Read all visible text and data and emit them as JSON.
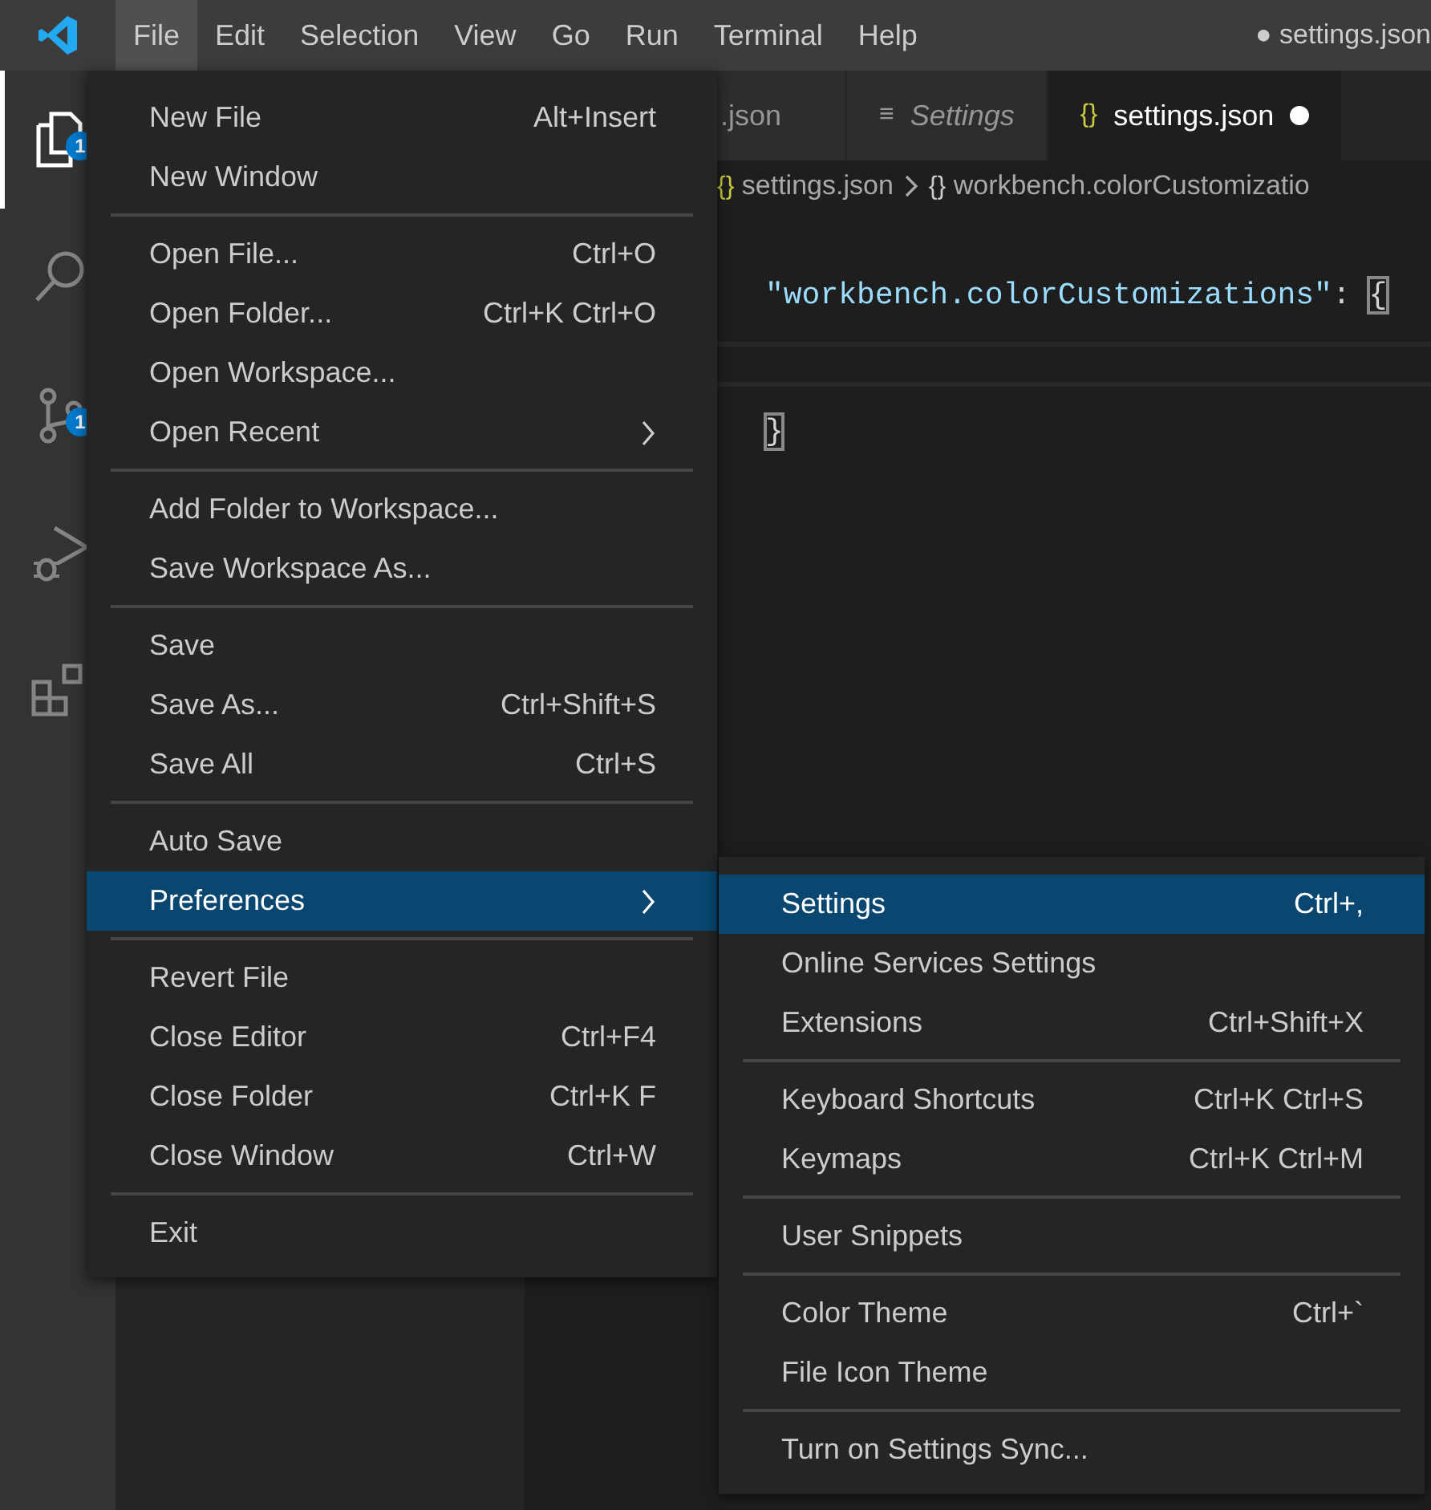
{
  "menubar": {
    "items": [
      {
        "label": "File",
        "selected": true
      },
      {
        "label": "Edit",
        "selected": false
      },
      {
        "label": "Selection",
        "selected": false
      },
      {
        "label": "View",
        "selected": false
      },
      {
        "label": "Go",
        "selected": false
      },
      {
        "label": "Run",
        "selected": false
      },
      {
        "label": "Terminal",
        "selected": false
      },
      {
        "label": "Help",
        "selected": false
      }
    ],
    "window_title": "● settings.json"
  },
  "activity_bar": {
    "items": [
      {
        "kind": "explorer",
        "selected": true,
        "badge": "1"
      },
      {
        "kind": "search",
        "selected": false
      },
      {
        "kind": "source-control",
        "selected": false,
        "badge": "1"
      },
      {
        "kind": "run-debug",
        "selected": false
      },
      {
        "kind": "extensions",
        "selected": false
      }
    ]
  },
  "tabs": [
    {
      "label": ".json",
      "selected": false
    },
    {
      "label": "Settings",
      "icon": "≡",
      "italic": true,
      "selected": false
    },
    {
      "label": "settings.json",
      "icon": "{}",
      "selected": true,
      "dirty": true
    }
  ],
  "breadcrumb": [
    {
      "icon": "{}",
      "label": "settings.json"
    },
    {
      "icon": "{}",
      "label": "workbench.colorCustomizatio"
    }
  ],
  "editor": {
    "lines": [
      {
        "tokens": [
          {
            "kind": "key",
            "text": "\"workbench.colorCustomizations\""
          },
          {
            "kind": "punct",
            "text": ": "
          },
          {
            "kind": "bracket",
            "text": "{",
            "matched": true
          }
        ]
      },
      {
        "current": true
      },
      {
        "tokens": [
          {
            "kind": "bracket",
            "text": "}",
            "matched": true
          }
        ]
      }
    ]
  },
  "file_menu": {
    "groups": [
      [
        {
          "label": "New File",
          "shortcut": "Alt+Insert",
          "selected": false
        },
        {
          "label": "New Window",
          "selected": false
        }
      ],
      [
        {
          "label": "Open File...",
          "shortcut": "Ctrl+O",
          "selected": false
        },
        {
          "label": "Open Folder...",
          "shortcut": "Ctrl+K Ctrl+O",
          "selected": false
        },
        {
          "label": "Open Workspace...",
          "selected": false
        },
        {
          "label": "Open Recent",
          "submenu": true,
          "selected": false
        }
      ],
      [
        {
          "label": "Add Folder to Workspace...",
          "selected": false
        },
        {
          "label": "Save Workspace As...",
          "selected": false
        }
      ],
      [
        {
          "label": "Save",
          "selected": false
        },
        {
          "label": "Save As...",
          "shortcut": "Ctrl+Shift+S",
          "selected": false
        },
        {
          "label": "Save All",
          "shortcut": "Ctrl+S",
          "selected": false
        }
      ],
      [
        {
          "label": "Auto Save",
          "selected": false
        },
        {
          "label": "Preferences",
          "submenu": true,
          "selected": true
        }
      ],
      [
        {
          "label": "Revert File",
          "selected": false
        },
        {
          "label": "Close Editor",
          "shortcut": "Ctrl+F4",
          "selected": false
        },
        {
          "label": "Close Folder",
          "shortcut": "Ctrl+K F",
          "selected": false
        },
        {
          "label": "Close Window",
          "shortcut": "Ctrl+W",
          "selected": false
        }
      ],
      [
        {
          "label": "Exit",
          "selected": false
        }
      ]
    ]
  },
  "preferences_submenu": {
    "groups": [
      [
        {
          "label": "Settings",
          "shortcut": "Ctrl+,",
          "selected": true
        },
        {
          "label": "Online Services Settings",
          "selected": false
        },
        {
          "label": "Extensions",
          "shortcut": "Ctrl+Shift+X",
          "selected": false
        }
      ],
      [
        {
          "label": "Keyboard Shortcuts",
          "shortcut": "Ctrl+K Ctrl+S",
          "selected": false
        },
        {
          "label": "Keymaps",
          "shortcut": "Ctrl+K Ctrl+M",
          "selected": false
        }
      ],
      [
        {
          "label": "User Snippets",
          "selected": false
        }
      ],
      [
        {
          "label": "Color Theme",
          "shortcut": "Ctrl+`",
          "selected": false
        },
        {
          "label": "File Icon Theme",
          "selected": false
        }
      ],
      [
        {
          "label": "Turn on Settings Sync...",
          "selected": false
        }
      ]
    ]
  }
}
